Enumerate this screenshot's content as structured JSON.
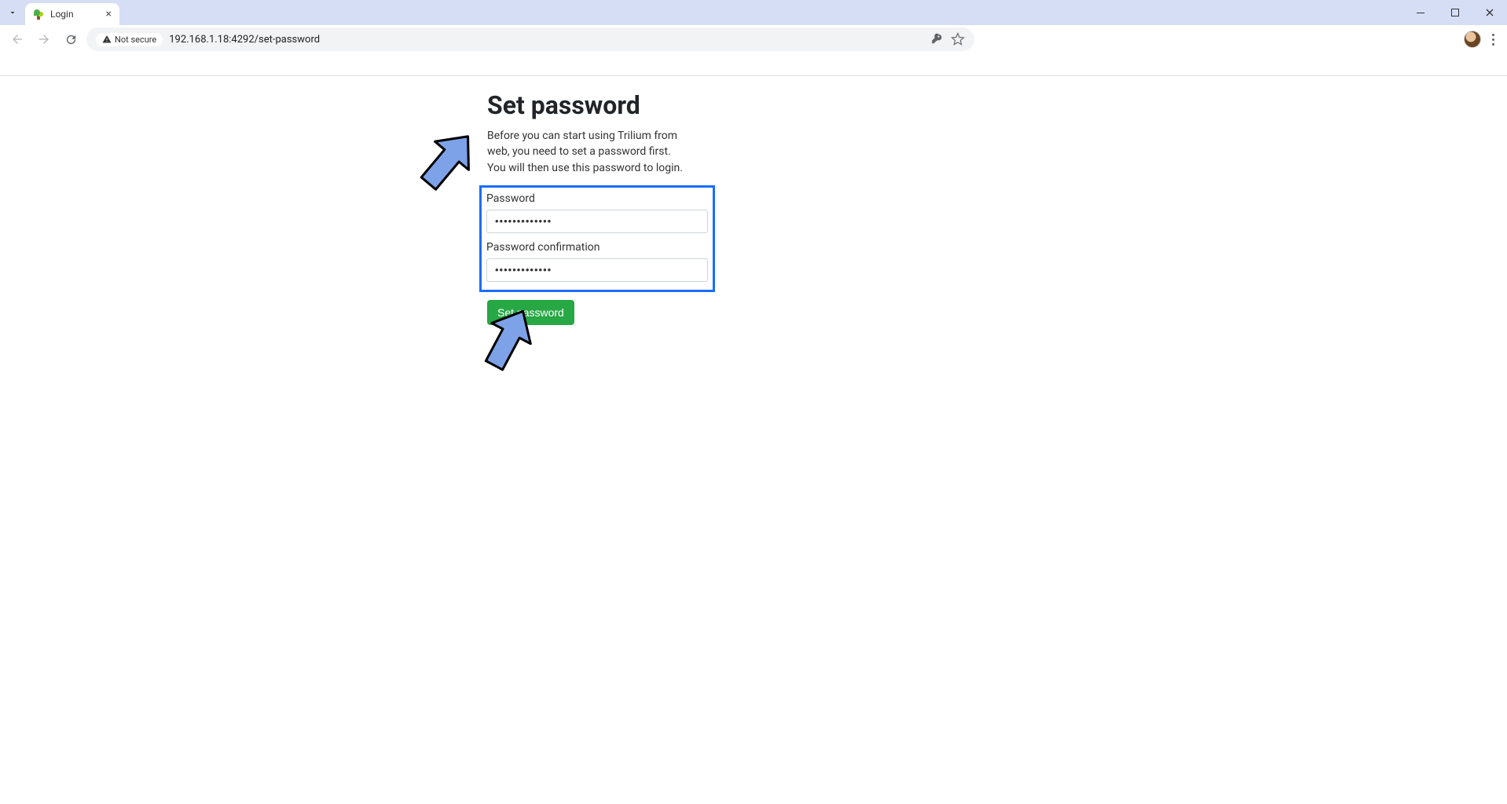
{
  "browser": {
    "tab_title": "Login",
    "security_label": "Not secure",
    "url": "192.168.1.18:4292/set-password"
  },
  "page": {
    "title": "Set password",
    "description": "Before you can start using Trilium from web, you need to set a password first. You will then use this password to login.",
    "password_label": "Password",
    "password_value": "•••••••••••••",
    "confirm_label": "Password confirmation",
    "confirm_value": "•••••••••••••",
    "submit_label": "Set password"
  }
}
